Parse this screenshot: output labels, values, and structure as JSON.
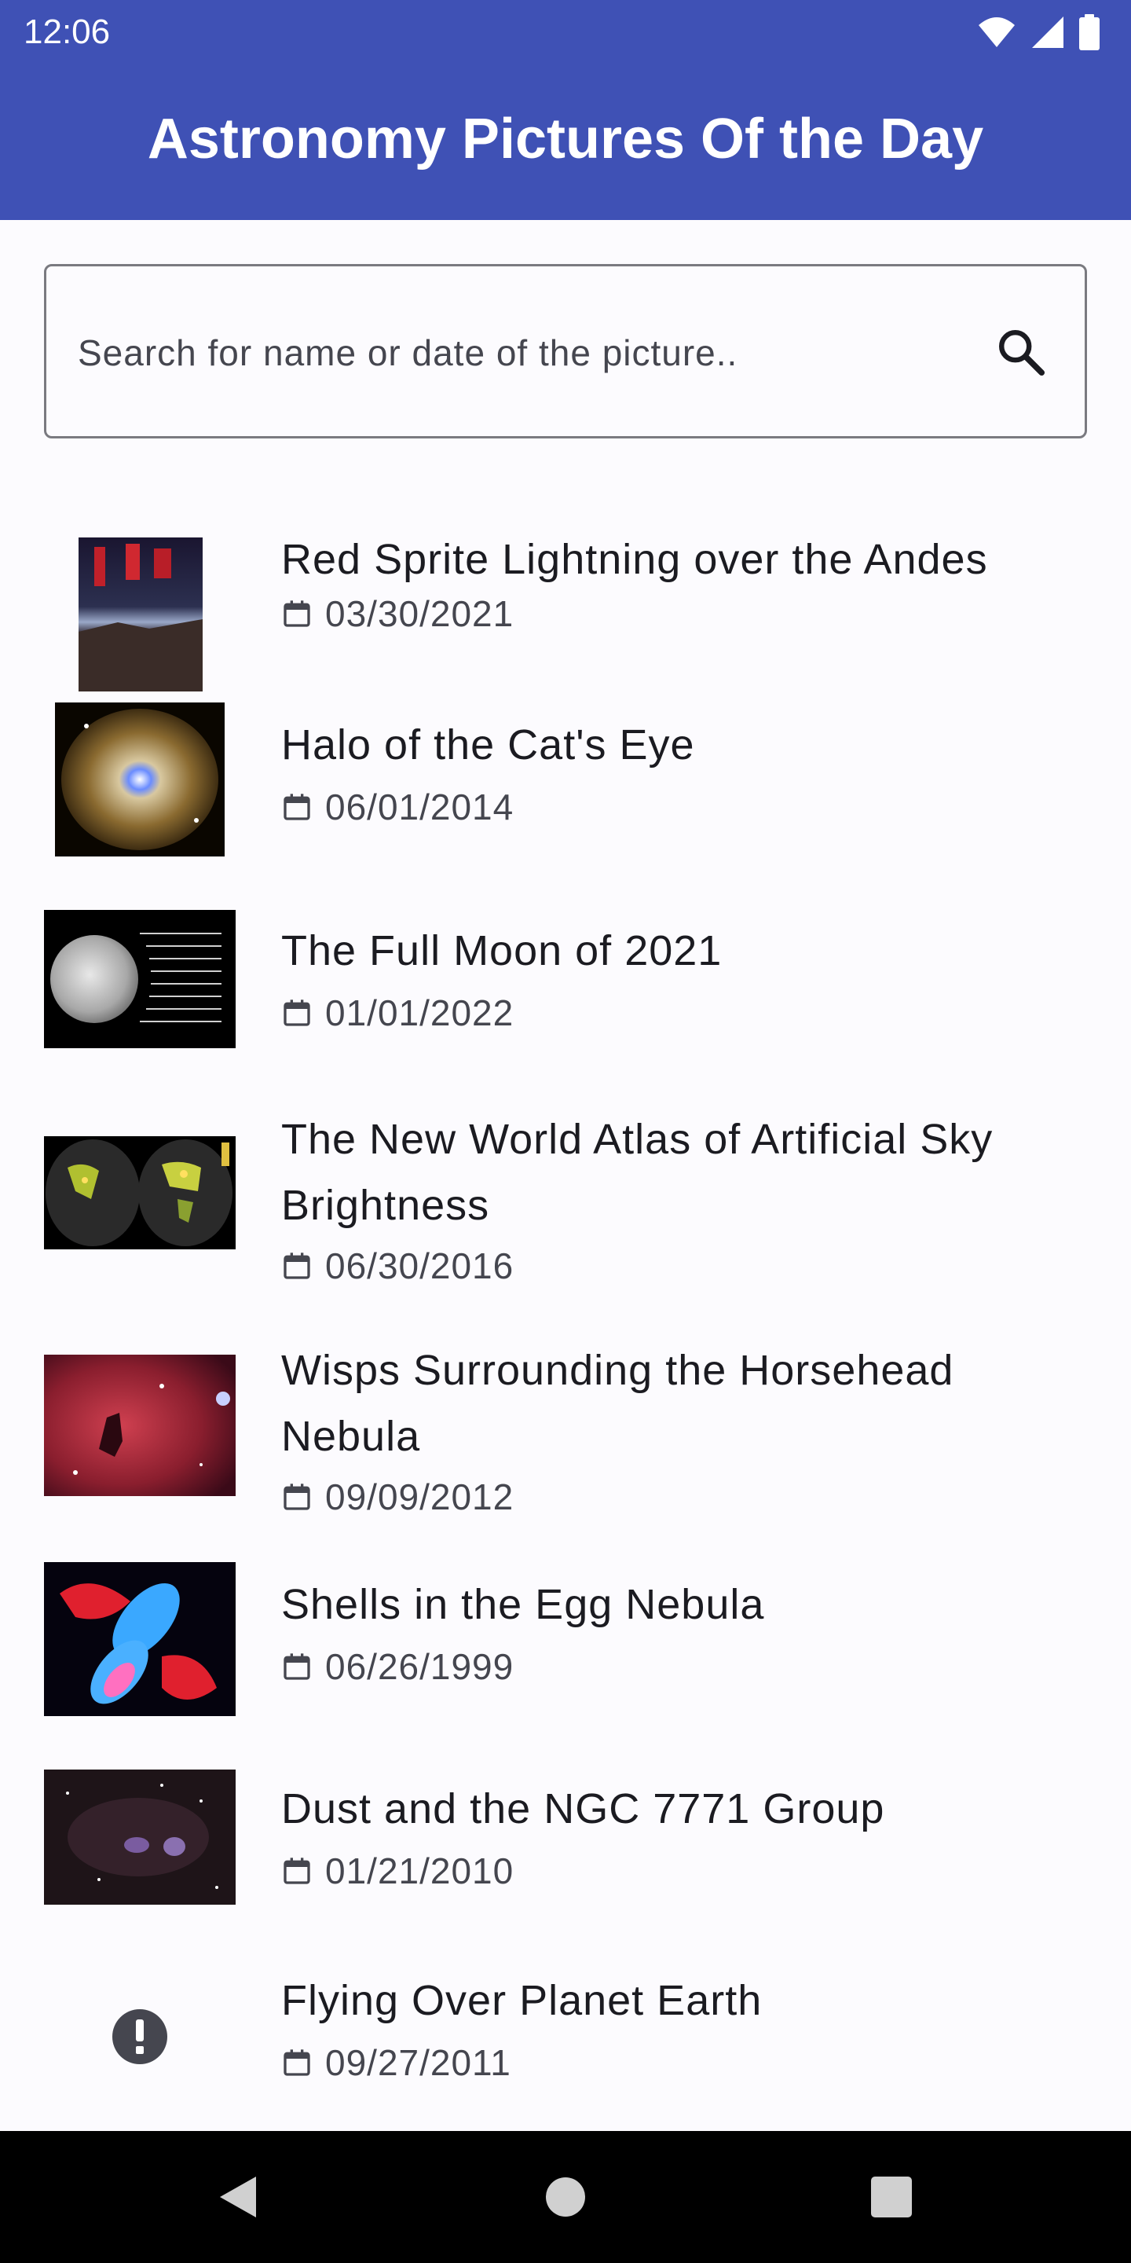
{
  "status_bar": {
    "time": "12:06",
    "icons": [
      "wifi-icon",
      "signal-icon",
      "battery-icon"
    ]
  },
  "app_bar": {
    "title": "Astronomy Pictures Of the Day",
    "color": "#3F51B5"
  },
  "search": {
    "placeholder": "Search for name or date of the picture..",
    "value": "",
    "icon": "search-icon"
  },
  "items": [
    {
      "title": "Red Sprite Lightning over the Andes",
      "date": "03/30/2021"
    },
    {
      "title": "Halo of the Cat's Eye",
      "date": "06/01/2014"
    },
    {
      "title": "The Full Moon of 2021",
      "date": "01/01/2022"
    },
    {
      "title": "The New World Atlas of Artificial Sky Brightness",
      "date": "06/30/2016"
    },
    {
      "title": "Wisps Surrounding the Horsehead Nebula",
      "date": "09/09/2012"
    },
    {
      "title": "Shells in the Egg Nebula",
      "date": "06/26/1999"
    },
    {
      "title": "Dust and the NGC 7771 Group",
      "date": "01/21/2010"
    },
    {
      "title": "Flying Over Planet Earth",
      "date": "09/27/2011"
    }
  ],
  "nav_bar": {
    "buttons": [
      "back-icon",
      "home-icon",
      "recents-icon"
    ]
  }
}
